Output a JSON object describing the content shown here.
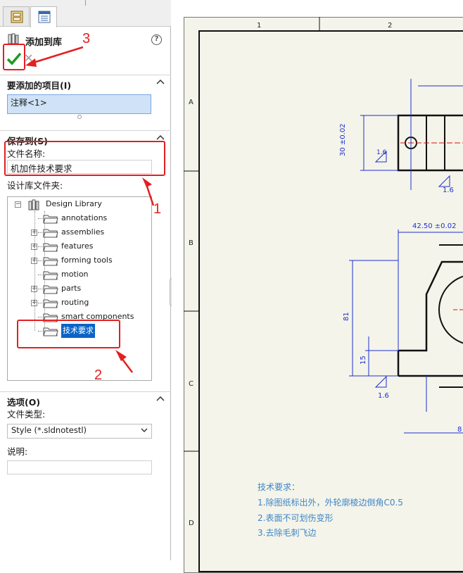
{
  "panel": {
    "title": "添加到库",
    "help_glyph": "?",
    "sections": {
      "items_to_add": {
        "title": "要添加的项目(I)",
        "selection": "注释<1>"
      },
      "save_to": {
        "title": "保存到(S)",
        "file_name_label": "文件名称:",
        "file_name_value": "机加件技术要求",
        "folder_label": "设计库文件夹:"
      },
      "options": {
        "title": "选项(O)",
        "file_type_label": "文件类型:",
        "file_type_value": "Style (*.sldnotestl)",
        "description_label": "说明:",
        "description_value": ""
      }
    },
    "tree": {
      "root": "Design Library",
      "children": [
        {
          "label": "annotations",
          "expandable": false
        },
        {
          "label": "assemblies",
          "expandable": true
        },
        {
          "label": "features",
          "expandable": true
        },
        {
          "label": "forming tools",
          "expandable": true
        },
        {
          "label": "motion",
          "expandable": false
        },
        {
          "label": "parts",
          "expandable": true
        },
        {
          "label": "routing",
          "expandable": true
        },
        {
          "label": "smart components",
          "expandable": false
        },
        {
          "label": "技术要求",
          "expandable": false,
          "selected": true
        }
      ]
    }
  },
  "drawing": {
    "zone_numbers": [
      "1",
      "2"
    ],
    "zone_letters": [
      "A",
      "B",
      "C",
      "D"
    ],
    "dimensions": {
      "d1": "30 ±0.02",
      "d2": "1.6",
      "d3": "1.6",
      "d4": "42.50 ±0.02",
      "d5": "81",
      "d6": "15",
      "d7": "1.6",
      "d8": "8"
    },
    "notes": [
      "技术要求：",
      "1.除图纸标出外，外轮廓棱边倒角C0.5",
      "2.表面不可划伤变形",
      "3.去除毛刺飞边"
    ]
  },
  "annotations": {
    "step1": "1",
    "step2": "2",
    "step3": "3"
  },
  "colors": {
    "annotation_red": "#e32020",
    "selection_blue": "#0a64c8",
    "note_blue": "#3f86c7",
    "dimension_blue": "#1f2fd0"
  },
  "icons": {
    "tab1": "property-manager-icon",
    "tab2": "feature-tree-icon",
    "title": "design-library-icon",
    "ok": "checkmark-icon",
    "cancel": "close-icon",
    "tree_root": "design-library-icon",
    "tree_item": "folder-icon"
  }
}
